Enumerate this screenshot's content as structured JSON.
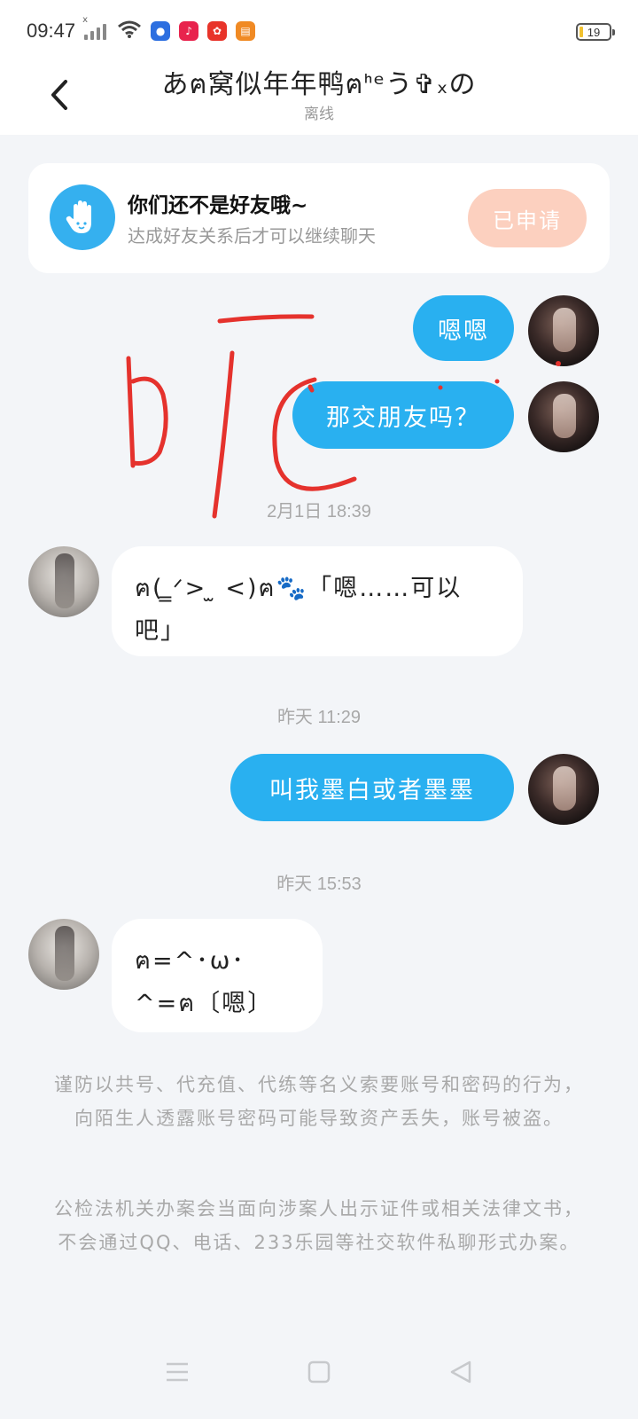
{
  "status_bar": {
    "time": "09:47",
    "battery": "19"
  },
  "header": {
    "title": "あฅ窝似年年鸭ฅᑋᵉう✞ₓの",
    "subtitle": "离线"
  },
  "friend_card": {
    "title": "你们还不是好友哦~",
    "subtitle": "达成好友关系后才可以继续聊天",
    "button": "已申请"
  },
  "messages": [
    {
      "from": "me",
      "text": "嗯嗯"
    },
    {
      "from": "me",
      "text": "那交朋友吗？"
    },
    {
      "timestamp": "2月1日  18:39"
    },
    {
      "from": "other",
      "text": "ฅ( ̳ᐟ> ̫ <)ฅ🐾「嗯……可以吧」"
    },
    {
      "timestamp": "昨天  11:29"
    },
    {
      "from": "me",
      "text": "叫我墨白或者墨墨"
    },
    {
      "timestamp": "昨天  15:53"
    },
    {
      "from": "other",
      "text": "ฅ=^･ω･^=ฅ〔嗯〕"
    }
  ],
  "notices": [
    "谨防以共号、代充值、代练等名义索要账号和密码的行为，向陌生人透露账号密码可能导致资产丢失，账号被盗。",
    "公检法机关办案会当面向涉案人出示证件或相关法律文书，不会通过QQ、电话、233乐园等社交软件私聊形式办案。"
  ],
  "colors": {
    "accent": "#29b0f0",
    "button_applied": "#fcd0bf",
    "background": "#f3f5f8",
    "scribble": "#e5322d"
  },
  "icons": {
    "back": "chevron-left-icon",
    "friend": "waving-hand-icon",
    "nav": [
      "menu-icon",
      "home-square-icon",
      "back-triangle-icon"
    ]
  }
}
